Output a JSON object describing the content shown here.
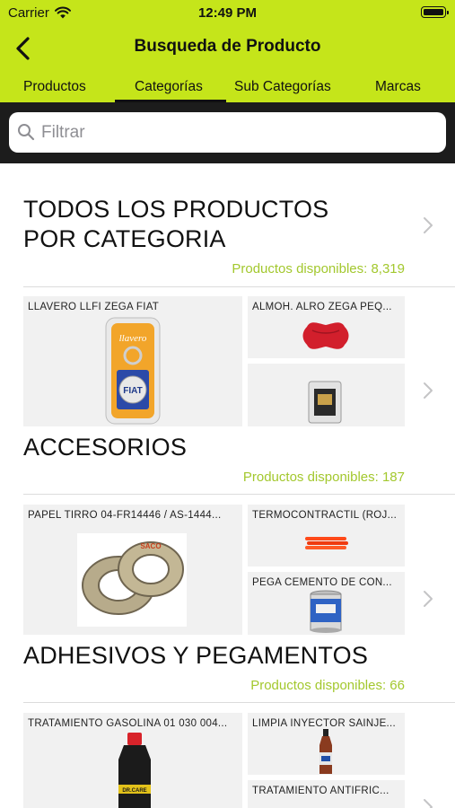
{
  "status": {
    "carrier": "Carrier",
    "time": "12:49 PM"
  },
  "nav": {
    "title": "Busqueda de Producto"
  },
  "tabs": [
    "Productos",
    "Categorías",
    "Sub Categorías",
    "Marcas"
  ],
  "active_tab": "Categorías",
  "search": {
    "placeholder": "Filtrar",
    "value": ""
  },
  "sections": [
    {
      "title_line1": "TODOS LOS PRODUCTOS",
      "title_line2": "POR CATEGORIA",
      "count": "Productos disponibles: 8,319",
      "products": [
        "LLAVERO LLFI ZEGA FIAT",
        "ALMOH. ALRO ZEGA  PEQ...",
        ""
      ]
    },
    {
      "title": "ACCESORIOS",
      "count": "Productos disponibles: 187",
      "products": [
        "PAPEL TIRRO 04-FR14446 / AS-1444...",
        "TERMOCONTRACTIL (ROJ...",
        "PEGA CEMENTO DE CON..."
      ]
    },
    {
      "title": "ADHESIVOS Y PEGAMENTOS",
      "count": "Productos disponibles: 66",
      "products": [
        "TRATAMIENTO GASOLINA 01 030 004...",
        "LIMPIA INYECTOR SAINJE...",
        "TRATAMIENTO ANTIFRIC..."
      ]
    }
  ],
  "image_text": {
    "keychain_word": "llavero",
    "keychain_brand": "FIAT",
    "tape_brand": "SACO",
    "bottle_brand": "DR.CARE"
  },
  "colors": {
    "accent": "#c5e51a",
    "count_text": "#a3c82e",
    "search_bg": "#1c1c1c"
  }
}
